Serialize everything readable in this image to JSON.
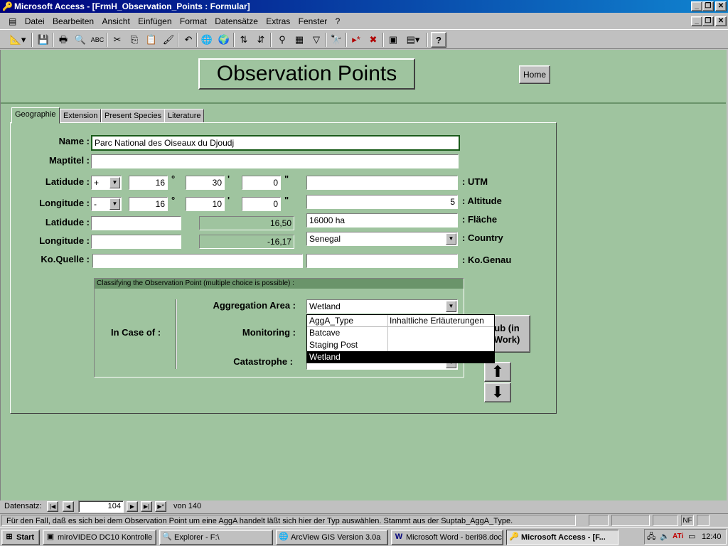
{
  "window": {
    "title": "Microsoft Access - [FrmH_Observation_Points : Formular]"
  },
  "menu": [
    "Datei",
    "Bearbeiten",
    "Ansicht",
    "Einfügen",
    "Format",
    "Datensätze",
    "Extras",
    "Fenster",
    "?"
  ],
  "form": {
    "title": "Observation Points",
    "home_label": "Home",
    "tabs": [
      "Geographie",
      "Extension",
      "Present Species",
      "Literature"
    ],
    "active_tab": "Geographie",
    "labels": {
      "name": "Name :",
      "maptitel": "Maptitel :",
      "latitude1": "Latidude :",
      "longitude1": "Longitude :",
      "latitude2": "Latidude :",
      "longitude2": "Longitude :",
      "ko_quelle": "Ko.Quelle :",
      "utm": ": UTM",
      "altitude": ": Altitude",
      "flaeche": ": Fläche",
      "country": ": Country",
      "ko_genau": ": Ko.Genau",
      "deg": "°",
      "min": "'",
      "sec": "\""
    },
    "values": {
      "name": "Parc National des Oiseaux du Djoudj",
      "maptitel": "",
      "lat_sign": "+",
      "lat_deg": "16",
      "lat_min": "30",
      "lat_sec": "0",
      "lon_sign": "-",
      "lon_deg": "16",
      "lon_min": "10",
      "lon_sec": "0",
      "latitude_text": "",
      "latitude_dec": "16,50",
      "longitude_text": "",
      "longitude_dec": "-16,17",
      "ko_quelle": "",
      "utm": "",
      "altitude": "5",
      "flaeche": "16000 ha",
      "country": "Senegal",
      "ko_genau": ""
    },
    "classification": {
      "heading": "Classifying the Observation Point (multiple choice is possible) :",
      "in_case_of": "In Case of :",
      "aggregation_label": "Aggregation Area :",
      "aggregation_value": "Wetland",
      "monitoring_label": "Monitoring :",
      "catastrophe_label": "Catastrophe :",
      "dropdown": {
        "headers": [
          "AggA_Type",
          "Inhaltliche Erläuterungen"
        ],
        "options": [
          "Batcave",
          "Staging Post",
          "Wetland"
        ],
        "selected": "Wetland"
      },
      "sub_button_label": "ub (in\nWork)"
    }
  },
  "nav": {
    "label": "Datensatz:",
    "record": "104",
    "of": "von 140"
  },
  "status": {
    "text": "Für den Fall, daß es sich bei dem Observation Point um eine AggA handelt läßt sich hier der Typ auswählen. Stammt aus der Suptab_AggA_Type.",
    "nf": "NF"
  },
  "taskbar": {
    "start": "Start",
    "tasks": [
      "miroVIDEO DC10 Kontrolle",
      "Explorer - F:\\",
      "ArcView GIS Version 3.0a",
      "Microsoft Word - beri98.doc",
      "Microsoft Access - [F..."
    ],
    "clock": "12:40"
  }
}
